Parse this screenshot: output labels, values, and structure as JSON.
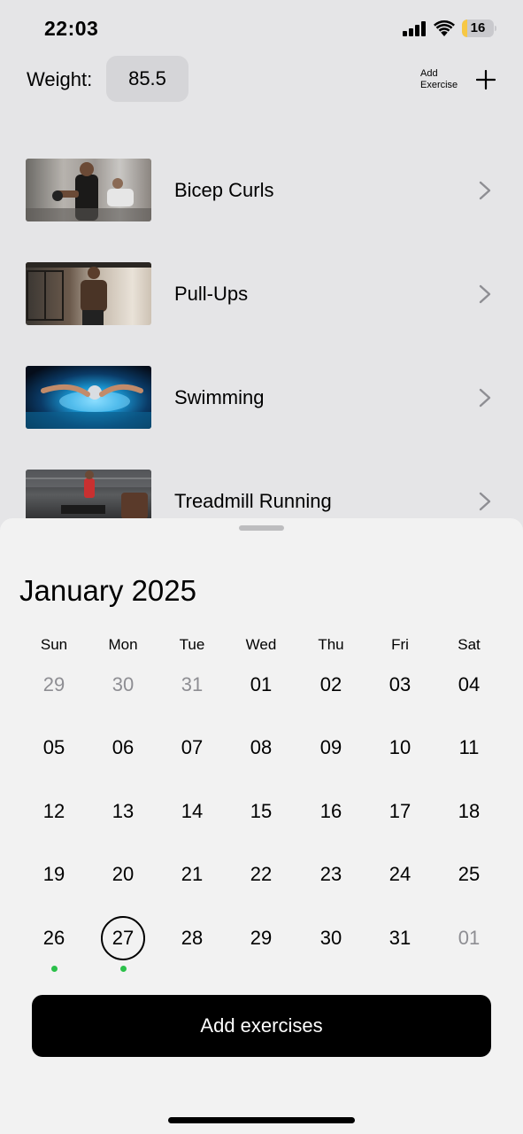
{
  "status_bar": {
    "time": "22:03",
    "battery_level": "16",
    "battery_color": "#f7c844",
    "signal_icon": "cellular-signal-icon",
    "wifi_icon": "wifi-icon"
  },
  "header": {
    "weight_label": "Weight:",
    "weight_value": "85.5",
    "add_exercise_line1": "Add",
    "add_exercise_line2": "Exercise",
    "add_icon": "plus-icon"
  },
  "exercises": [
    {
      "name": "Bicep Curls",
      "thumbnail": "bicep-curls-photo",
      "icon": "chevron-right-icon"
    },
    {
      "name": "Pull-Ups",
      "thumbnail": "pull-ups-photo",
      "icon": "chevron-right-icon"
    },
    {
      "name": "Swimming",
      "thumbnail": "swimming-photo",
      "icon": "chevron-right-icon"
    },
    {
      "name": "Treadmill Running",
      "thumbnail": "treadmill-running-photo",
      "icon": "chevron-right-icon"
    }
  ],
  "calendar": {
    "month_title": "January 2025",
    "weekdays": [
      "Sun",
      "Mon",
      "Tue",
      "Wed",
      "Thu",
      "Fri",
      "Sat"
    ],
    "weeks": [
      [
        {
          "day": "29",
          "outside_month": true
        },
        {
          "day": "30",
          "outside_month": true
        },
        {
          "day": "31",
          "outside_month": true
        },
        {
          "day": "01"
        },
        {
          "day": "02"
        },
        {
          "day": "03"
        },
        {
          "day": "04"
        }
      ],
      [
        {
          "day": "05"
        },
        {
          "day": "06"
        },
        {
          "day": "07"
        },
        {
          "day": "08"
        },
        {
          "day": "09"
        },
        {
          "day": "10"
        },
        {
          "day": "11"
        }
      ],
      [
        {
          "day": "12"
        },
        {
          "day": "13"
        },
        {
          "day": "14"
        },
        {
          "day": "15"
        },
        {
          "day": "16"
        },
        {
          "day": "17"
        },
        {
          "day": "18"
        }
      ],
      [
        {
          "day": "19"
        },
        {
          "day": "20"
        },
        {
          "day": "21"
        },
        {
          "day": "22"
        },
        {
          "day": "23"
        },
        {
          "day": "24"
        },
        {
          "day": "25"
        }
      ],
      [
        {
          "day": "26",
          "has_activity": true
        },
        {
          "day": "27",
          "selected": true,
          "has_activity": true
        },
        {
          "day": "28"
        },
        {
          "day": "29"
        },
        {
          "day": "30"
        },
        {
          "day": "31"
        },
        {
          "day": "01",
          "outside_month": true
        }
      ]
    ],
    "activity_dot_color": "#2bc04a"
  },
  "add_button_label": "Add exercises"
}
